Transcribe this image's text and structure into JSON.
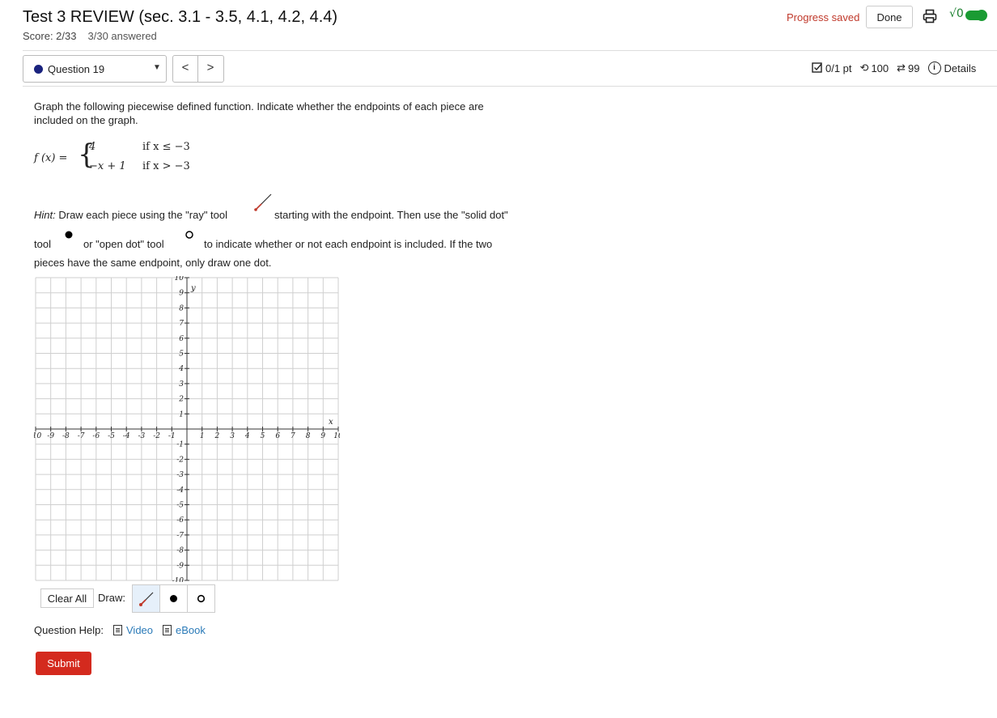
{
  "header": {
    "title": "Test 3 REVIEW (sec. 3.1 - 3.5, 4.1, 4.2, 4.4)",
    "score": "Score: 2/33",
    "answered": "3/30 answered",
    "progress_text": "Progress saved",
    "done_label": "Done",
    "sqrt_label": "√0"
  },
  "question_nav": {
    "selected": "Question 19",
    "prev": "<",
    "next": ">"
  },
  "meta": {
    "points": "0/1 pt",
    "retries": "100",
    "attempts": "99",
    "details": "Details"
  },
  "question": {
    "prompt_line1": "Graph the following piecewise defined function. Indicate whether the endpoints of each piece are",
    "prompt_line2": "included on the graph.",
    "formula": {
      "lhs": "f (x) =",
      "rows": [
        {
          "expr": "4",
          "cond": "if  x ≤ −3"
        },
        {
          "expr": "−x + 1",
          "cond": "if  x > −3"
        }
      ]
    },
    "hint_label": "Hint:",
    "hint_part1": " Draw each piece using the \"ray\" tool",
    "hint_part2": "starting with the endpoint. Then use the \"solid dot\"",
    "hint_tool": "tool",
    "hint_or": "or \"open dot\" tool",
    "hint_part3": "to indicate whether or not each endpoint is included. If the two",
    "hint_line3": "pieces have the same endpoint, only draw one dot."
  },
  "graph": {
    "xmin": -10,
    "xmax": 10,
    "ymin": -10,
    "ymax": 10,
    "grid": true,
    "x_label": "x",
    "y_label": "y"
  },
  "tools": {
    "clear_label": "Clear All",
    "draw_label": "Draw:",
    "items": [
      "ray-tool",
      "solid-dot-tool",
      "open-dot-tool"
    ],
    "selected": "ray-tool"
  },
  "help": {
    "label": "Question Help:",
    "video": "Video",
    "ebook": "eBook"
  },
  "submit_label": "Submit",
  "colors": {
    "progress": "#c0392b",
    "submit": "#d42a1e",
    "toggle": "#1a9b33",
    "link": "#2a7ab8"
  }
}
